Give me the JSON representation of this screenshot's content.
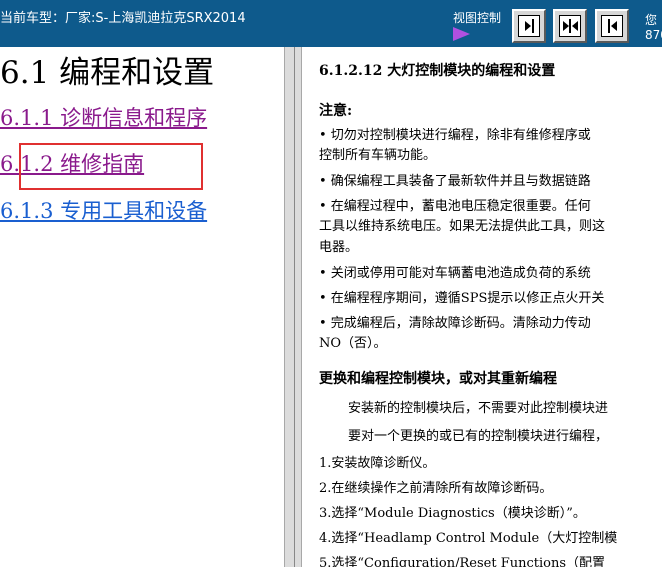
{
  "topbar": {
    "vehicle_info": "当前车型：厂家:S-上海凯迪拉克SRX2014",
    "view_control_label": "视图控制",
    "right_info_1": "您",
    "right_info_2": "870"
  },
  "toc": {
    "title": "6.1 编程和设置",
    "items": [
      {
        "label": "6.1.1 诊断信息和程序"
      },
      {
        "label": "6.1.2 维修指南"
      },
      {
        "label": "6.1.3 专用工具和设备"
      }
    ]
  },
  "content": {
    "title": "6.1.2.12 大灯控制模块的编程和设置",
    "note_label": "注意:",
    "lines": [
      "• 切勿对控制模块进行编程，除非有维修程序或",
      "控制所有车辆功能。",
      "• 确保编程工具装备了最新软件并且与数据链路",
      "• 在编程过程中，蓄电池电压稳定很重要。任何",
      "工具以维持系统电压。如果无法提供此工具，则这",
      "电器。",
      "• 关闭或停用可能对车辆蓄电池造成负荷的系统",
      "• 在编程程序期间，遵循SPS提示以修正点火开关",
      "• 完成编程后，清除故障诊断码。清除动力传动",
      "NO（否）。"
    ],
    "section_title": "更换和编程控制模块，或对其重新编程",
    "para1": "安装新的控制模块后，不需要对此控制模块进",
    "para2": "要对一个更换的或已有的控制模块进行编程，",
    "steps": [
      "1.安装故障诊断仪。",
      "2.在继续操作之前清除所有故障诊断码。",
      "3.选择“Module Diagnostics（模块诊断）”。",
      "4.选择“Headlamp Control Module（大灯控制模",
      "5.选择“Configuration/Reset Functions（配置"
    ]
  }
}
